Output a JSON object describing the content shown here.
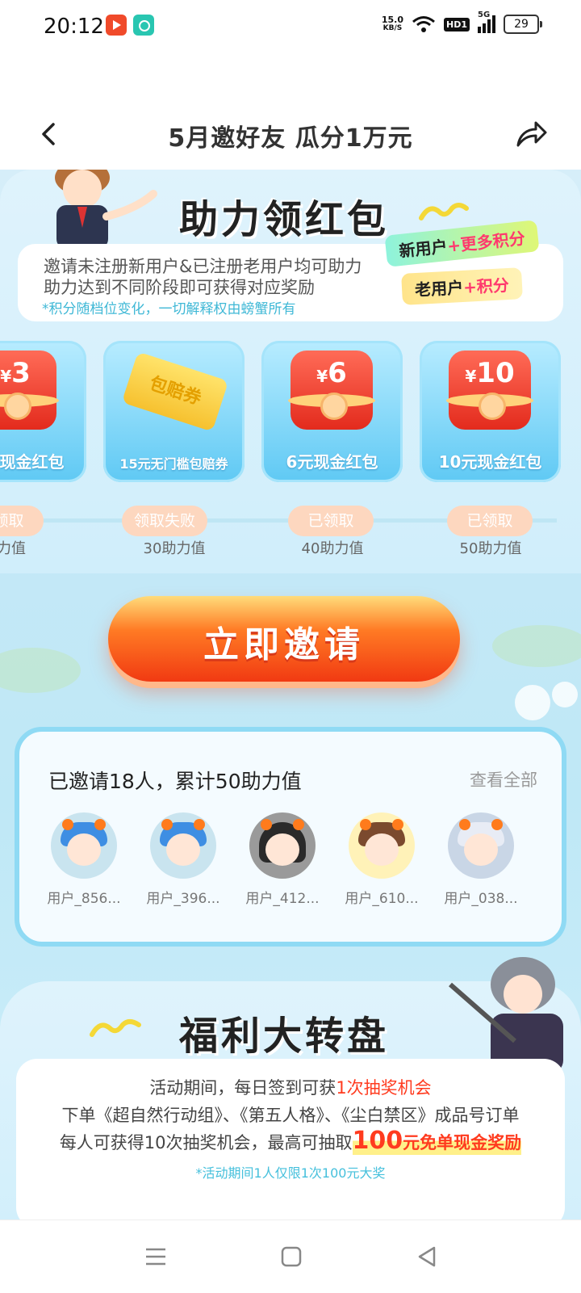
{
  "status": {
    "time": "20:12",
    "net_speed_value": "15.0",
    "net_speed_unit": "KB/S",
    "hd": "HD1",
    "network": "5G",
    "battery": "29"
  },
  "header": {
    "title": "5月邀好友 瓜分1万元"
  },
  "boost": {
    "title": "助力领红包",
    "line1": "邀请未注册新用户&已注册老用户均可助力",
    "line2": "助力达到不同阶段即可获得对应奖励",
    "note": "*积分随档位变化，一切解释权由螃蟹所有",
    "tag_new_prefix": "新用户",
    "tag_new_suffix": "+更多积分",
    "tag_old_prefix": "老用户",
    "tag_old_suffix": "+积分"
  },
  "rewards": [
    {
      "amount": "3",
      "label": "现金红包",
      "status": "已领取",
      "points": "助力值"
    },
    {
      "ticket": "包赔券",
      "label": "15元无门槛包赔券",
      "status": "领取失败",
      "points": "30助力值"
    },
    {
      "amount": "6",
      "label": "6元现金红包",
      "status": "已领取",
      "points": "40助力值"
    },
    {
      "amount": "10",
      "label": "10元现金红包",
      "status": "已领取",
      "points": "50助力值"
    }
  ],
  "currency_symbol": "¥",
  "invite_button": "立即邀请",
  "invited": {
    "summary": "已邀请18人，累计50助力值",
    "view_all": "查看全部",
    "friends": [
      {
        "name": "用户_856..."
      },
      {
        "name": "用户_396..."
      },
      {
        "name": "用户_412..."
      },
      {
        "name": "用户_610..."
      },
      {
        "name": "用户_038..."
      }
    ]
  },
  "wheel": {
    "title": "福利大转盘",
    "line1_a": "活动期间，每日签到可获",
    "line1_b": "1次抽奖机会",
    "line2": "下单《超自然行动组》、《第五人格》、《尘白禁区》成品号订单",
    "line3_a": "每人可获得10次抽奖机会，最高可抽取",
    "line3_num": "100",
    "line3_b": "元免单现金奖励",
    "note": "*活动期间1人仅限1次100元大奖"
  },
  "colors": {
    "accent_red": "#ff3b1f",
    "accent_teal": "#3fb8d6",
    "card_blue": "#5fc9f4"
  }
}
